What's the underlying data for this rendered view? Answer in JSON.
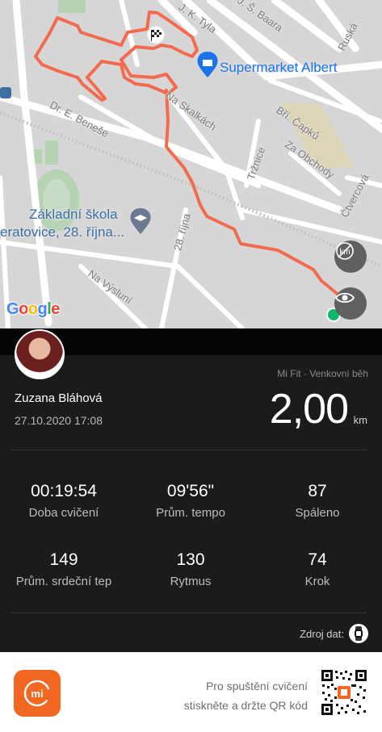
{
  "map": {
    "streets": [
      "J. K. Tyla",
      "J. Š. Baara",
      "Ruská",
      "Na Skalkách",
      "Dr. E. Beneše",
      "Bří. Čapků",
      "Za Obchody",
      "Tržnice",
      "Čtvercová",
      "28. října",
      "Na Výsluní"
    ],
    "poi_supermarket": "Supermarket Albert",
    "poi_school_line1": "Základní škola",
    "poi_school_line2": "eratovice, 28. října...",
    "attribution": "Google",
    "route_color": "#f36b4f",
    "buttons": {
      "km_markers": "km-markers-off-icon",
      "visibility": "eye-icon"
    }
  },
  "workout": {
    "user_name": "Zuzana Bláhová",
    "datetime": "27.10.2020 17:08",
    "source_type": "Mi Fit · Venkovní běh",
    "distance": "2,00",
    "distance_unit": "km"
  },
  "stats": [
    {
      "value": "00:19:54",
      "label": "Doba cvičení"
    },
    {
      "value": "09'56\"",
      "label": "Prům. tempo"
    },
    {
      "value": "87",
      "label": "Spáleno"
    },
    {
      "value": "149",
      "label": "Prům. srdeční tep"
    },
    {
      "value": "130",
      "label": "Rytmus"
    },
    {
      "value": "74",
      "label": "Krok"
    }
  ],
  "data_source_label": "Zdroj dat:",
  "footer": {
    "qr_line1": "Pro spuštění cvičení",
    "qr_line2": "stiskněte a držte QR kód",
    "logo_text": "mi"
  },
  "colors": {
    "accent": "#f26722",
    "panel": "#1b1b1b",
    "start_dot": "#12b76a"
  }
}
